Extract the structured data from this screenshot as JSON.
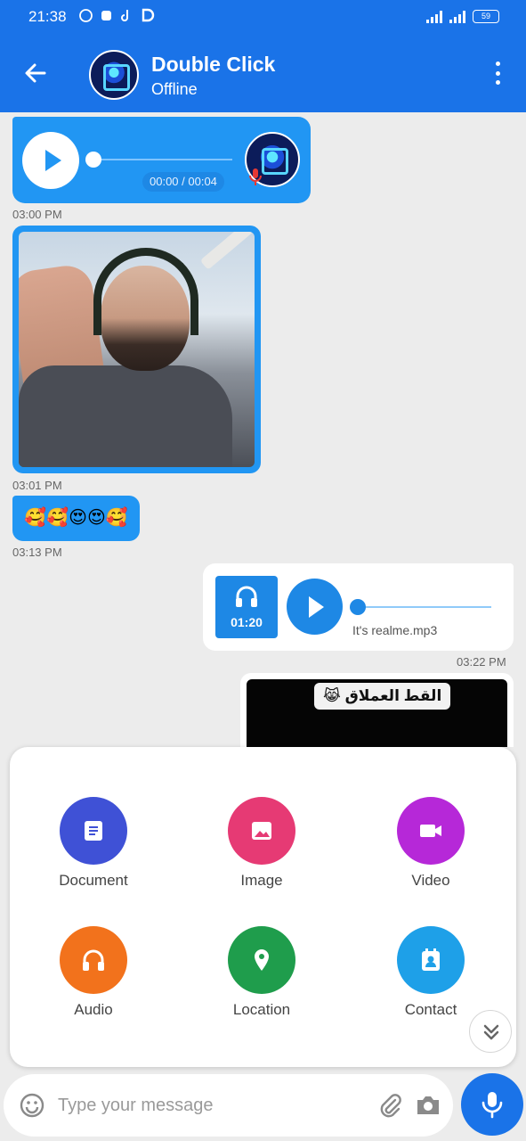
{
  "status_bar": {
    "time": "21:38",
    "battery": "59"
  },
  "header": {
    "contact_name": "Double Click",
    "contact_status": "Offline"
  },
  "messages": [
    {
      "type": "audio",
      "direction": "incoming",
      "duration": "00:00 / 00:04",
      "time": "03:00 PM"
    },
    {
      "type": "image",
      "direction": "incoming",
      "time": "03:01 PM"
    },
    {
      "type": "text",
      "direction": "incoming",
      "text": "🥰🥰😍😍🥰",
      "time": "03:13 PM"
    },
    {
      "type": "audio_file",
      "direction": "outgoing",
      "file_duration": "01:20",
      "file_name": "It's realme.mp3",
      "time": "03:22 PM"
    },
    {
      "type": "video",
      "direction": "outgoing",
      "caption": "القط العملاق 😹"
    }
  ],
  "attachment_options": [
    {
      "label": "Document",
      "icon": "document-icon",
      "color": "#3f51d6"
    },
    {
      "label": "Image",
      "icon": "image-icon",
      "color": "#e63a74"
    },
    {
      "label": "Video",
      "icon": "video-icon",
      "color": "#b628d8"
    },
    {
      "label": "Audio",
      "icon": "headphones-icon",
      "color": "#f2721c"
    },
    {
      "label": "Location",
      "icon": "location-icon",
      "color": "#1f9d4c"
    },
    {
      "label": "Contact",
      "icon": "contact-icon",
      "color": "#1ea0e8"
    }
  ],
  "input": {
    "placeholder": "Type your message"
  },
  "colors": {
    "primary": "#1a73e8",
    "incoming_bubble": "#2196f3",
    "outgoing_bubble": "#ffffff",
    "chat_bg": "#ececec"
  }
}
